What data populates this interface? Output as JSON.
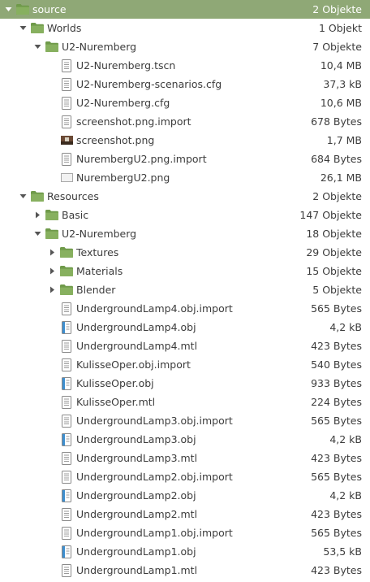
{
  "tree": {
    "rows": [
      {
        "name": "source",
        "size": "2 Objekte",
        "type": "folder",
        "depth": 0,
        "arrow": "open",
        "selected": true
      },
      {
        "name": "Worlds",
        "size": "1 Objekt",
        "type": "folder",
        "depth": 1,
        "arrow": "open"
      },
      {
        "name": "U2-Nuremberg",
        "size": "7 Objekte",
        "type": "folder",
        "depth": 2,
        "arrow": "open"
      },
      {
        "name": "U2-Nuremberg.tscn",
        "size": "10,4 MB",
        "type": "text",
        "depth": 3
      },
      {
        "name": "U2-Nuremberg-scenarios.cfg",
        "size": "37,3 kB",
        "type": "text",
        "depth": 3
      },
      {
        "name": "U2-Nuremberg.cfg",
        "size": "10,6 MB",
        "type": "text",
        "depth": 3
      },
      {
        "name": "screenshot.png.import",
        "size": "678 Bytes",
        "type": "text",
        "depth": 3
      },
      {
        "name": "screenshot.png",
        "size": "1,7 MB",
        "type": "image-photo",
        "depth": 3
      },
      {
        "name": "NurembergU2.png.import",
        "size": "684 Bytes",
        "type": "text",
        "depth": 3
      },
      {
        "name": "NurembergU2.png",
        "size": "26,1 MB",
        "type": "image-blank",
        "depth": 3
      },
      {
        "name": "Resources",
        "size": "2 Objekte",
        "type": "folder",
        "depth": 1,
        "arrow": "open"
      },
      {
        "name": "Basic",
        "size": "147 Objekte",
        "type": "folder",
        "depth": 2,
        "arrow": "closed"
      },
      {
        "name": "U2-Nuremberg",
        "size": "18 Objekte",
        "type": "folder",
        "depth": 2,
        "arrow": "open"
      },
      {
        "name": "Textures",
        "size": "29 Objekte",
        "type": "folder",
        "depth": 3,
        "arrow": "closed"
      },
      {
        "name": "Materials",
        "size": "15 Objekte",
        "type": "folder",
        "depth": 3,
        "arrow": "closed"
      },
      {
        "name": "Blender",
        "size": "5 Objekte",
        "type": "folder",
        "depth": 3,
        "arrow": "closed"
      },
      {
        "name": "UndergroundLamp4.obj.import",
        "size": "565 Bytes",
        "type": "text",
        "depth": 3
      },
      {
        "name": "UndergroundLamp4.obj",
        "size": "4,2 kB",
        "type": "obj",
        "depth": 3
      },
      {
        "name": "UndergroundLamp4.mtl",
        "size": "423 Bytes",
        "type": "text",
        "depth": 3
      },
      {
        "name": "KulisseOper.obj.import",
        "size": "540 Bytes",
        "type": "text",
        "depth": 3
      },
      {
        "name": "KulisseOper.obj",
        "size": "933 Bytes",
        "type": "obj",
        "depth": 3
      },
      {
        "name": "KulisseOper.mtl",
        "size": "224 Bytes",
        "type": "text",
        "depth": 3
      },
      {
        "name": "UndergroundLamp3.obj.import",
        "size": "565 Bytes",
        "type": "text",
        "depth": 3
      },
      {
        "name": "UndergroundLamp3.obj",
        "size": "4,2 kB",
        "type": "obj",
        "depth": 3
      },
      {
        "name": "UndergroundLamp3.mtl",
        "size": "423 Bytes",
        "type": "text",
        "depth": 3
      },
      {
        "name": "UndergroundLamp2.obj.import",
        "size": "565 Bytes",
        "type": "text",
        "depth": 3
      },
      {
        "name": "UndergroundLamp2.obj",
        "size": "4,2 kB",
        "type": "obj",
        "depth": 3
      },
      {
        "name": "UndergroundLamp2.mtl",
        "size": "423 Bytes",
        "type": "text",
        "depth": 3
      },
      {
        "name": "UndergroundLamp1.obj.import",
        "size": "565 Bytes",
        "type": "text",
        "depth": 3
      },
      {
        "name": "UndergroundLamp1.obj",
        "size": "53,5 kB",
        "type": "obj",
        "depth": 3
      },
      {
        "name": "UndergroundLamp1.mtl",
        "size": "423 Bytes",
        "type": "text",
        "depth": 3
      }
    ]
  },
  "colors": {
    "selection": "#8fa876",
    "folder": "#7fa65a",
    "folder_dark": "#5f8a3c",
    "text": "#3c3c3c",
    "arrow": "#555555"
  }
}
